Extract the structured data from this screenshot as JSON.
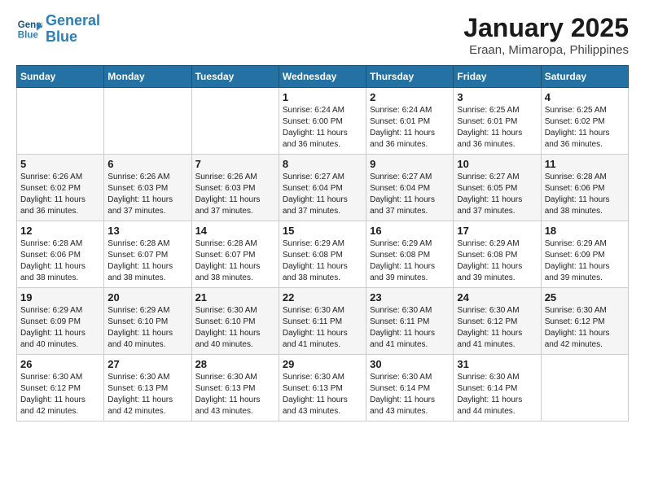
{
  "logo": {
    "line1": "General",
    "line2": "Blue"
  },
  "title": "January 2025",
  "subtitle": "Eraan, Mimaropa, Philippines",
  "weekdays": [
    "Sunday",
    "Monday",
    "Tuesday",
    "Wednesday",
    "Thursday",
    "Friday",
    "Saturday"
  ],
  "weeks": [
    [
      {
        "day": "",
        "info": ""
      },
      {
        "day": "",
        "info": ""
      },
      {
        "day": "",
        "info": ""
      },
      {
        "day": "1",
        "info": "Sunrise: 6:24 AM\nSunset: 6:00 PM\nDaylight: 11 hours and 36 minutes."
      },
      {
        "day": "2",
        "info": "Sunrise: 6:24 AM\nSunset: 6:01 PM\nDaylight: 11 hours and 36 minutes."
      },
      {
        "day": "3",
        "info": "Sunrise: 6:25 AM\nSunset: 6:01 PM\nDaylight: 11 hours and 36 minutes."
      },
      {
        "day": "4",
        "info": "Sunrise: 6:25 AM\nSunset: 6:02 PM\nDaylight: 11 hours and 36 minutes."
      }
    ],
    [
      {
        "day": "5",
        "info": "Sunrise: 6:26 AM\nSunset: 6:02 PM\nDaylight: 11 hours and 36 minutes."
      },
      {
        "day": "6",
        "info": "Sunrise: 6:26 AM\nSunset: 6:03 PM\nDaylight: 11 hours and 37 minutes."
      },
      {
        "day": "7",
        "info": "Sunrise: 6:26 AM\nSunset: 6:03 PM\nDaylight: 11 hours and 37 minutes."
      },
      {
        "day": "8",
        "info": "Sunrise: 6:27 AM\nSunset: 6:04 PM\nDaylight: 11 hours and 37 minutes."
      },
      {
        "day": "9",
        "info": "Sunrise: 6:27 AM\nSunset: 6:04 PM\nDaylight: 11 hours and 37 minutes."
      },
      {
        "day": "10",
        "info": "Sunrise: 6:27 AM\nSunset: 6:05 PM\nDaylight: 11 hours and 37 minutes."
      },
      {
        "day": "11",
        "info": "Sunrise: 6:28 AM\nSunset: 6:06 PM\nDaylight: 11 hours and 38 minutes."
      }
    ],
    [
      {
        "day": "12",
        "info": "Sunrise: 6:28 AM\nSunset: 6:06 PM\nDaylight: 11 hours and 38 minutes."
      },
      {
        "day": "13",
        "info": "Sunrise: 6:28 AM\nSunset: 6:07 PM\nDaylight: 11 hours and 38 minutes."
      },
      {
        "day": "14",
        "info": "Sunrise: 6:28 AM\nSunset: 6:07 PM\nDaylight: 11 hours and 38 minutes."
      },
      {
        "day": "15",
        "info": "Sunrise: 6:29 AM\nSunset: 6:08 PM\nDaylight: 11 hours and 38 minutes."
      },
      {
        "day": "16",
        "info": "Sunrise: 6:29 AM\nSunset: 6:08 PM\nDaylight: 11 hours and 39 minutes."
      },
      {
        "day": "17",
        "info": "Sunrise: 6:29 AM\nSunset: 6:08 PM\nDaylight: 11 hours and 39 minutes."
      },
      {
        "day": "18",
        "info": "Sunrise: 6:29 AM\nSunset: 6:09 PM\nDaylight: 11 hours and 39 minutes."
      }
    ],
    [
      {
        "day": "19",
        "info": "Sunrise: 6:29 AM\nSunset: 6:09 PM\nDaylight: 11 hours and 40 minutes."
      },
      {
        "day": "20",
        "info": "Sunrise: 6:29 AM\nSunset: 6:10 PM\nDaylight: 11 hours and 40 minutes."
      },
      {
        "day": "21",
        "info": "Sunrise: 6:30 AM\nSunset: 6:10 PM\nDaylight: 11 hours and 40 minutes."
      },
      {
        "day": "22",
        "info": "Sunrise: 6:30 AM\nSunset: 6:11 PM\nDaylight: 11 hours and 41 minutes."
      },
      {
        "day": "23",
        "info": "Sunrise: 6:30 AM\nSunset: 6:11 PM\nDaylight: 11 hours and 41 minutes."
      },
      {
        "day": "24",
        "info": "Sunrise: 6:30 AM\nSunset: 6:12 PM\nDaylight: 11 hours and 41 minutes."
      },
      {
        "day": "25",
        "info": "Sunrise: 6:30 AM\nSunset: 6:12 PM\nDaylight: 11 hours and 42 minutes."
      }
    ],
    [
      {
        "day": "26",
        "info": "Sunrise: 6:30 AM\nSunset: 6:12 PM\nDaylight: 11 hours and 42 minutes."
      },
      {
        "day": "27",
        "info": "Sunrise: 6:30 AM\nSunset: 6:13 PM\nDaylight: 11 hours and 42 minutes."
      },
      {
        "day": "28",
        "info": "Sunrise: 6:30 AM\nSunset: 6:13 PM\nDaylight: 11 hours and 43 minutes."
      },
      {
        "day": "29",
        "info": "Sunrise: 6:30 AM\nSunset: 6:13 PM\nDaylight: 11 hours and 43 minutes."
      },
      {
        "day": "30",
        "info": "Sunrise: 6:30 AM\nSunset: 6:14 PM\nDaylight: 11 hours and 43 minutes."
      },
      {
        "day": "31",
        "info": "Sunrise: 6:30 AM\nSunset: 6:14 PM\nDaylight: 11 hours and 44 minutes."
      },
      {
        "day": "",
        "info": ""
      }
    ]
  ]
}
